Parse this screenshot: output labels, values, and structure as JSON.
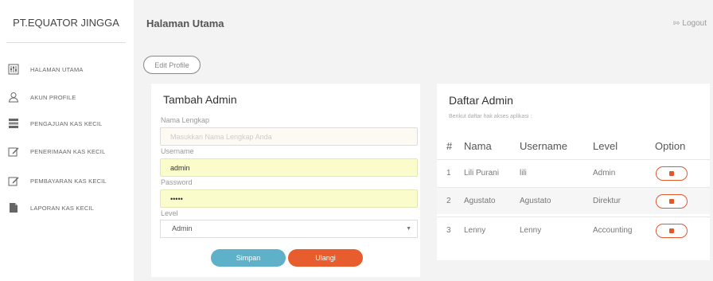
{
  "sidebar": {
    "brand": "PT.EQUATOR JINGGA",
    "items": [
      {
        "label": "HALAMAN UTAMA",
        "icon": "dashboard-icon"
      },
      {
        "label": "AKUN PROFILE",
        "icon": "user-icon"
      },
      {
        "label": "PENGAJUAN KAS KECIL",
        "icon": "list-icon"
      },
      {
        "label": "PENERIMAAN KAS KECIL",
        "icon": "edit-icon"
      },
      {
        "label": "PEMBAYARAN KAS KECIL",
        "icon": "edit-icon"
      },
      {
        "label": "LAPORAN KAS KECIL",
        "icon": "file-icon"
      }
    ]
  },
  "header": {
    "title": "Halaman Utama",
    "logout_label": "Logout"
  },
  "edit_profile_label": "Edit Profile",
  "form": {
    "title": "Tambah Admin",
    "name_label": "Nama Lengkap",
    "name_placeholder": "Masukkan Nama Lengkap Anda",
    "username_label": "Username",
    "username_value": "admin",
    "password_label": "Password",
    "password_value": "•••••",
    "level_label": "Level",
    "level_selected": "Admin",
    "save_label": "Simpan",
    "reset_label": "Ulangi"
  },
  "admins": {
    "title": "Daftar Admin",
    "description": "Berikut daftar hak akses aplikasi :",
    "columns": [
      "#",
      "Nama",
      "Username",
      "Level",
      "Option"
    ],
    "rows": [
      {
        "no": "1",
        "nama": "Lili Purani",
        "username": "lili",
        "level": "Admin"
      },
      {
        "no": "2",
        "nama": "Agustato",
        "username": "Agustato",
        "level": "Direktur"
      },
      {
        "no": "3",
        "nama": "Lenny",
        "username": "Lenny",
        "level": "Accounting"
      }
    ]
  },
  "colors": {
    "accent_blue": "#5fb0c9",
    "accent_orange": "#e85d2e",
    "filled_input": "#fafccc"
  }
}
